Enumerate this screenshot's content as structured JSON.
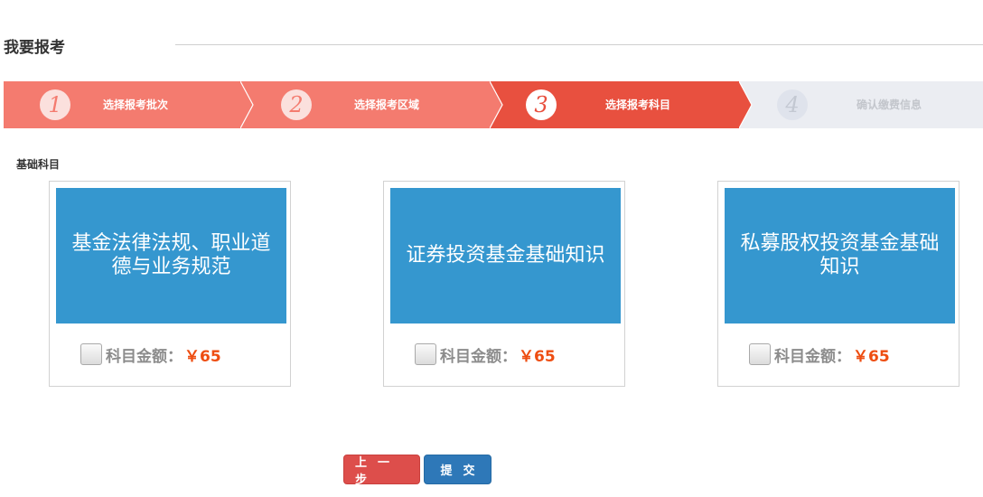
{
  "page": {
    "title": "我要报考"
  },
  "steps": [
    {
      "number": "1",
      "label": "选择报考批次",
      "state": "done"
    },
    {
      "number": "2",
      "label": "选择报考区域",
      "state": "done"
    },
    {
      "number": "3",
      "label": "选择报考科目",
      "state": "active"
    },
    {
      "number": "4",
      "label": "确认缴费信息",
      "state": "pending"
    }
  ],
  "colors": {
    "step_done": "#f47b6f",
    "step_active": "#e8503f",
    "step_pending": "#ebedf2",
    "banner": "#3597cf",
    "price": "#ee4d11"
  },
  "section": {
    "label": "基础科目"
  },
  "subjects": [
    {
      "name": "基金法律法规、职业道德与业务规范",
      "fee_label": "科目金额：",
      "fee": "￥65",
      "checked": false
    },
    {
      "name": "证券投资基金基础知识",
      "fee_label": "科目金额：",
      "fee": "￥65",
      "checked": false
    },
    {
      "name": "私募股权投资基金基础知识",
      "fee_label": "科目金额：",
      "fee": "￥65",
      "checked": false
    }
  ],
  "buttons": {
    "prev": "上一步",
    "submit": "提交"
  }
}
